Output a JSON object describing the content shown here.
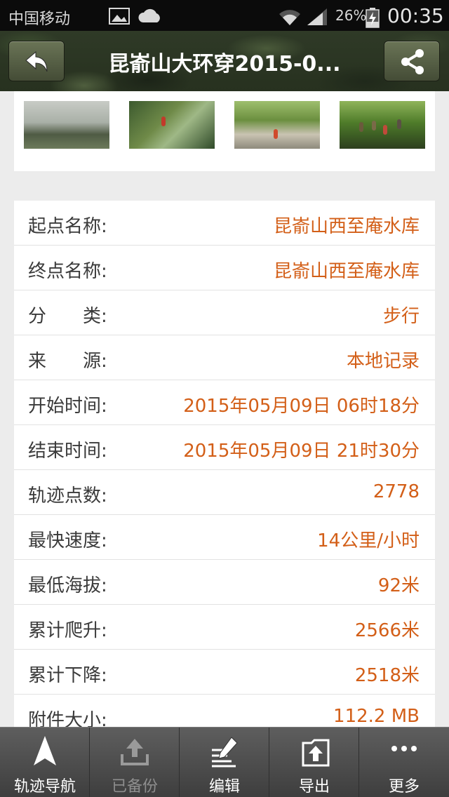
{
  "status_bar": {
    "carrier": "中国移动",
    "battery": "26%",
    "time": "00:35"
  },
  "header": {
    "title": "昆嵛山大环穿2015-0...",
    "back_icon": "back-arrow-icon",
    "share_icon": "share-icon"
  },
  "photos": [
    {
      "name": "misty reservoir"
    },
    {
      "name": "hiker on rocks"
    },
    {
      "name": "hikers by stream"
    },
    {
      "name": "group in forest"
    }
  ],
  "details": [
    {
      "label": "起点名称:",
      "value": "昆嵛山西至庵水库"
    },
    {
      "label": "终点名称:",
      "value": "昆嵛山西至庵水库"
    },
    {
      "label": "分　　类:",
      "value": "步行"
    },
    {
      "label": "来　　源:",
      "value": "本地记录"
    },
    {
      "label": "开始时间:",
      "value": "2015年05月09日 06时18分"
    },
    {
      "label": "结束时间:",
      "value": "2015年05月09日 21时30分"
    },
    {
      "label": "轨迹点数:",
      "value": "2778"
    },
    {
      "label": "最快速度:",
      "value": "14公里/小时"
    },
    {
      "label": "最低海拔:",
      "value": "92米"
    },
    {
      "label": "累计爬升:",
      "value": "2566米"
    },
    {
      "label": "累计下降:",
      "value": "2518米"
    },
    {
      "label": "附件大小:",
      "value": "112.2 MB"
    }
  ],
  "toolbar": {
    "items": [
      {
        "label": "轨迹导航",
        "icon": "navigation-arrow-icon",
        "enabled": true
      },
      {
        "label": "已备份",
        "icon": "upload-icon",
        "enabled": false
      },
      {
        "label": "编辑",
        "icon": "edit-icon",
        "enabled": true
      },
      {
        "label": "导出",
        "icon": "export-icon",
        "enabled": true
      },
      {
        "label": "更多",
        "icon": "more-icon",
        "enabled": true
      }
    ]
  },
  "colors": {
    "value_text": "#d35f18",
    "header_camo": "#2f3a27",
    "toolbar_bg": "#4e4e4e"
  }
}
